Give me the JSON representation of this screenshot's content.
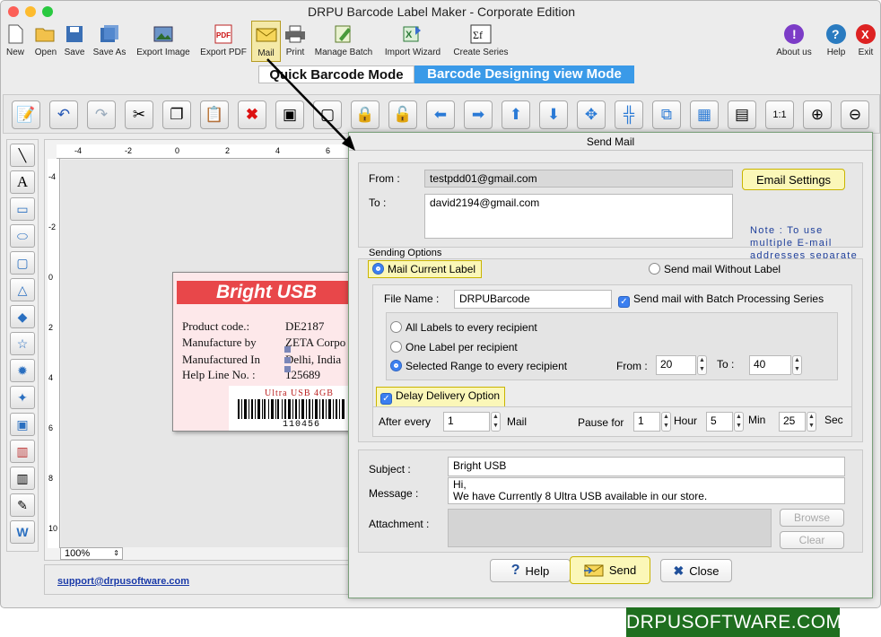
{
  "window": {
    "title": "DRPU Barcode Label Maker - Corporate Edition"
  },
  "toolbar": {
    "items": [
      {
        "label": "New",
        "icon": "new-document-icon"
      },
      {
        "label": "Open",
        "icon": "open-folder-icon"
      },
      {
        "label": "Save",
        "icon": "save-icon"
      },
      {
        "label": "Save As",
        "icon": "save-as-icon"
      },
      {
        "label": "Export Image",
        "icon": "export-image-icon"
      },
      {
        "label": "Export PDF",
        "icon": "export-pdf-icon"
      },
      {
        "label": "Mail",
        "icon": "mail-icon"
      },
      {
        "label": "Print",
        "icon": "print-icon"
      },
      {
        "label": "Manage Batch",
        "icon": "manage-batch-icon"
      },
      {
        "label": "Import Wizard",
        "icon": "import-wizard-icon"
      },
      {
        "label": "Create Series",
        "icon": "create-series-icon"
      }
    ],
    "right": [
      {
        "label": "About us",
        "icon": "about-icon"
      },
      {
        "label": "Help",
        "icon": "help-icon"
      },
      {
        "label": "Exit",
        "icon": "exit-icon"
      }
    ]
  },
  "modes": {
    "quick": "Quick Barcode Mode",
    "designing": "Barcode Designing view Mode"
  },
  "ruler": {
    "top": [
      "-4",
      "-2",
      "0",
      "2",
      "4",
      "6"
    ],
    "left": [
      "-4",
      "-2",
      "0",
      "2",
      "4",
      "6",
      "8",
      "10"
    ]
  },
  "label": {
    "title": "Bright USB",
    "fields": [
      {
        "name": "Product code.:",
        "value": "DE2187"
      },
      {
        "name": "Manufacture by",
        "value": "ZETA Corpo"
      },
      {
        "name": "Manufactured In",
        "value": "Delhi, India"
      },
      {
        "name": "Help Line No. :",
        "value": "125689"
      }
    ],
    "barcode_caption": "Ultra USB 4GB",
    "barcode_number": "110456"
  },
  "zoom": "100%",
  "support_link": "support@drpusoftware.com",
  "dialog": {
    "title": "Send Mail",
    "from_label": "From :",
    "from_value": "testpdd01@gmail.com",
    "to_label": "To :",
    "to_value": "david2194@gmail.com",
    "email_settings": "Email Settings",
    "note": "Note : To use multiple E-mail addresses separate it using Comma(,)",
    "sending_options": "Sending Options",
    "mail_current_label": "Mail Current Label",
    "send_without_label": "Send mail Without Label",
    "file_name_label": "File Name :",
    "file_name_value": "DRPUBarcode",
    "batch_series": "Send mail with Batch Processing Series",
    "all_labels": "All Labels to every recipient",
    "one_label": "One Label per recipient",
    "selected_range": "Selected Range to every recipient",
    "from_range_label": "From :",
    "from_range_value": "20",
    "to_range_label": "To :",
    "to_range_value": "40",
    "delay_option": "Delay Delivery Option",
    "after_every": "After every",
    "after_value": "1",
    "mail_unit": "Mail",
    "pause_for": "Pause for",
    "hour_value": "1",
    "hour_unit": "Hour",
    "min_value": "5",
    "min_unit": "Min",
    "sec_value": "25",
    "sec_unit": "Sec",
    "subject_label": "Subject :",
    "subject_value": "Bright USB",
    "message_label": "Message :",
    "message_line1": "Hi,",
    "message_line2": "We have Currently 8 Ultra USB available in our store.",
    "attachment_label": "Attachment :",
    "browse": "Browse",
    "clear": "Clear",
    "help": "Help",
    "send": "Send",
    "close": "Close"
  },
  "brand": "DRPUSOFTWARE.COM",
  "colors": {
    "accent": "#3b7ff0",
    "highlight": "#fbf7b8",
    "label_red": "#e8474a",
    "brand_green": "#1f6f1f"
  }
}
